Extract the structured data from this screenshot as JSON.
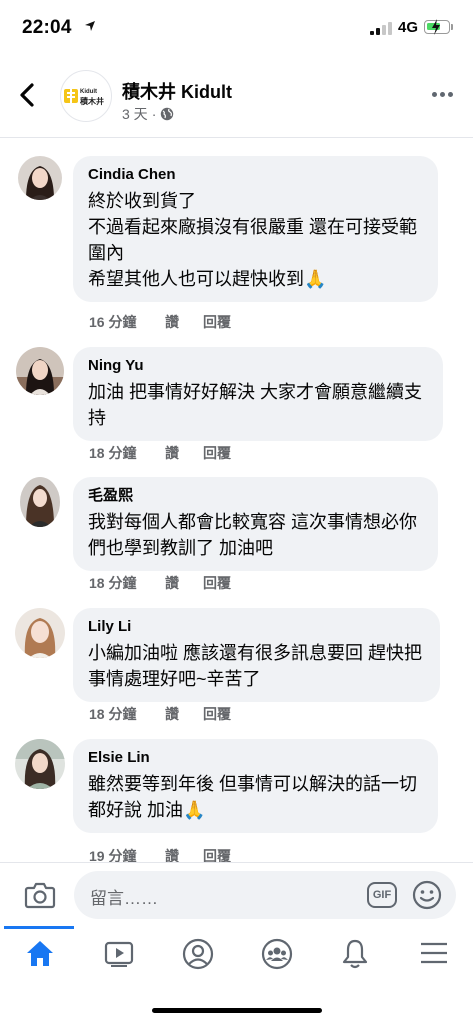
{
  "status_bar": {
    "time": "22:04",
    "network": "4G"
  },
  "header": {
    "page_name": "積木井 Kidult",
    "post_age": "3 天",
    "separator": "·",
    "logo_en": "Kidult",
    "logo_zh": "積木井"
  },
  "comments": [
    {
      "name": "Cindia Chen",
      "text": "終於收到貨了\n不過看起來廠損沒有很嚴重 還在可接受範圍內\n希望其他人也可以趕快收到🙏",
      "time": "16 分鐘",
      "like": "讚",
      "reply": "回覆"
    },
    {
      "name": "Ning Yu",
      "text": "加油 把事情好好解決 大家才會願意繼續支持",
      "time": "18 分鐘",
      "like": "讚",
      "reply": "回覆"
    },
    {
      "name": "毛盈熙",
      "text": "我對每個人都會比較寬容 這次事情想必你們也學到教訓了 加油吧",
      "time": "18 分鐘",
      "like": "讚",
      "reply": "回覆"
    },
    {
      "name": "Lily Li",
      "text": "小編加油啦 應該還有很多訊息要回 趕快把事情處理好吧~辛苦了",
      "time": "18 分鐘",
      "like": "讚",
      "reply": "回覆"
    },
    {
      "name": "Elsie Lin",
      "text": "雖然要等到年後 但事情可以解決的話一切都好說 加油🙏",
      "time": "19 分鐘",
      "like": "讚",
      "reply": "回覆"
    }
  ],
  "composer": {
    "placeholder": "留言……",
    "gif_label": "GIF"
  },
  "tabs": [
    {
      "name": "home",
      "icon": "home-icon",
      "active": true
    },
    {
      "name": "watch",
      "icon": "video-icon",
      "active": false
    },
    {
      "name": "profile",
      "icon": "profile-icon",
      "active": false
    },
    {
      "name": "groups",
      "icon": "groups-icon",
      "active": false
    },
    {
      "name": "notifications",
      "icon": "bell-icon",
      "active": false
    },
    {
      "name": "menu",
      "icon": "menu-icon",
      "active": false
    }
  ],
  "colors": {
    "accent": "#1877f2",
    "bubble": "#f0f2f5",
    "secondary_text": "#65676b",
    "battery": "#4cd964"
  }
}
